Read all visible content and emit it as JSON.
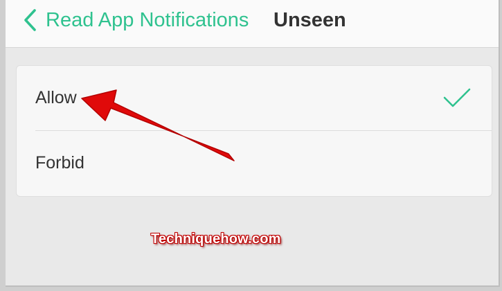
{
  "header": {
    "back_icon": "chevron-left-icon",
    "back_label": "Read App Notifications",
    "title": "Unseen"
  },
  "options": [
    {
      "label": "Allow",
      "selected": true,
      "indicator_icon": "checkmark-icon"
    },
    {
      "label": "Forbid",
      "selected": false
    }
  ],
  "watermark": "Techniquehow.com",
  "colors": {
    "accent": "#2fc28f",
    "annotation": "#e00a0a",
    "text": "#333333",
    "background": "#e9e9e9",
    "card": "#f7f7f7"
  }
}
